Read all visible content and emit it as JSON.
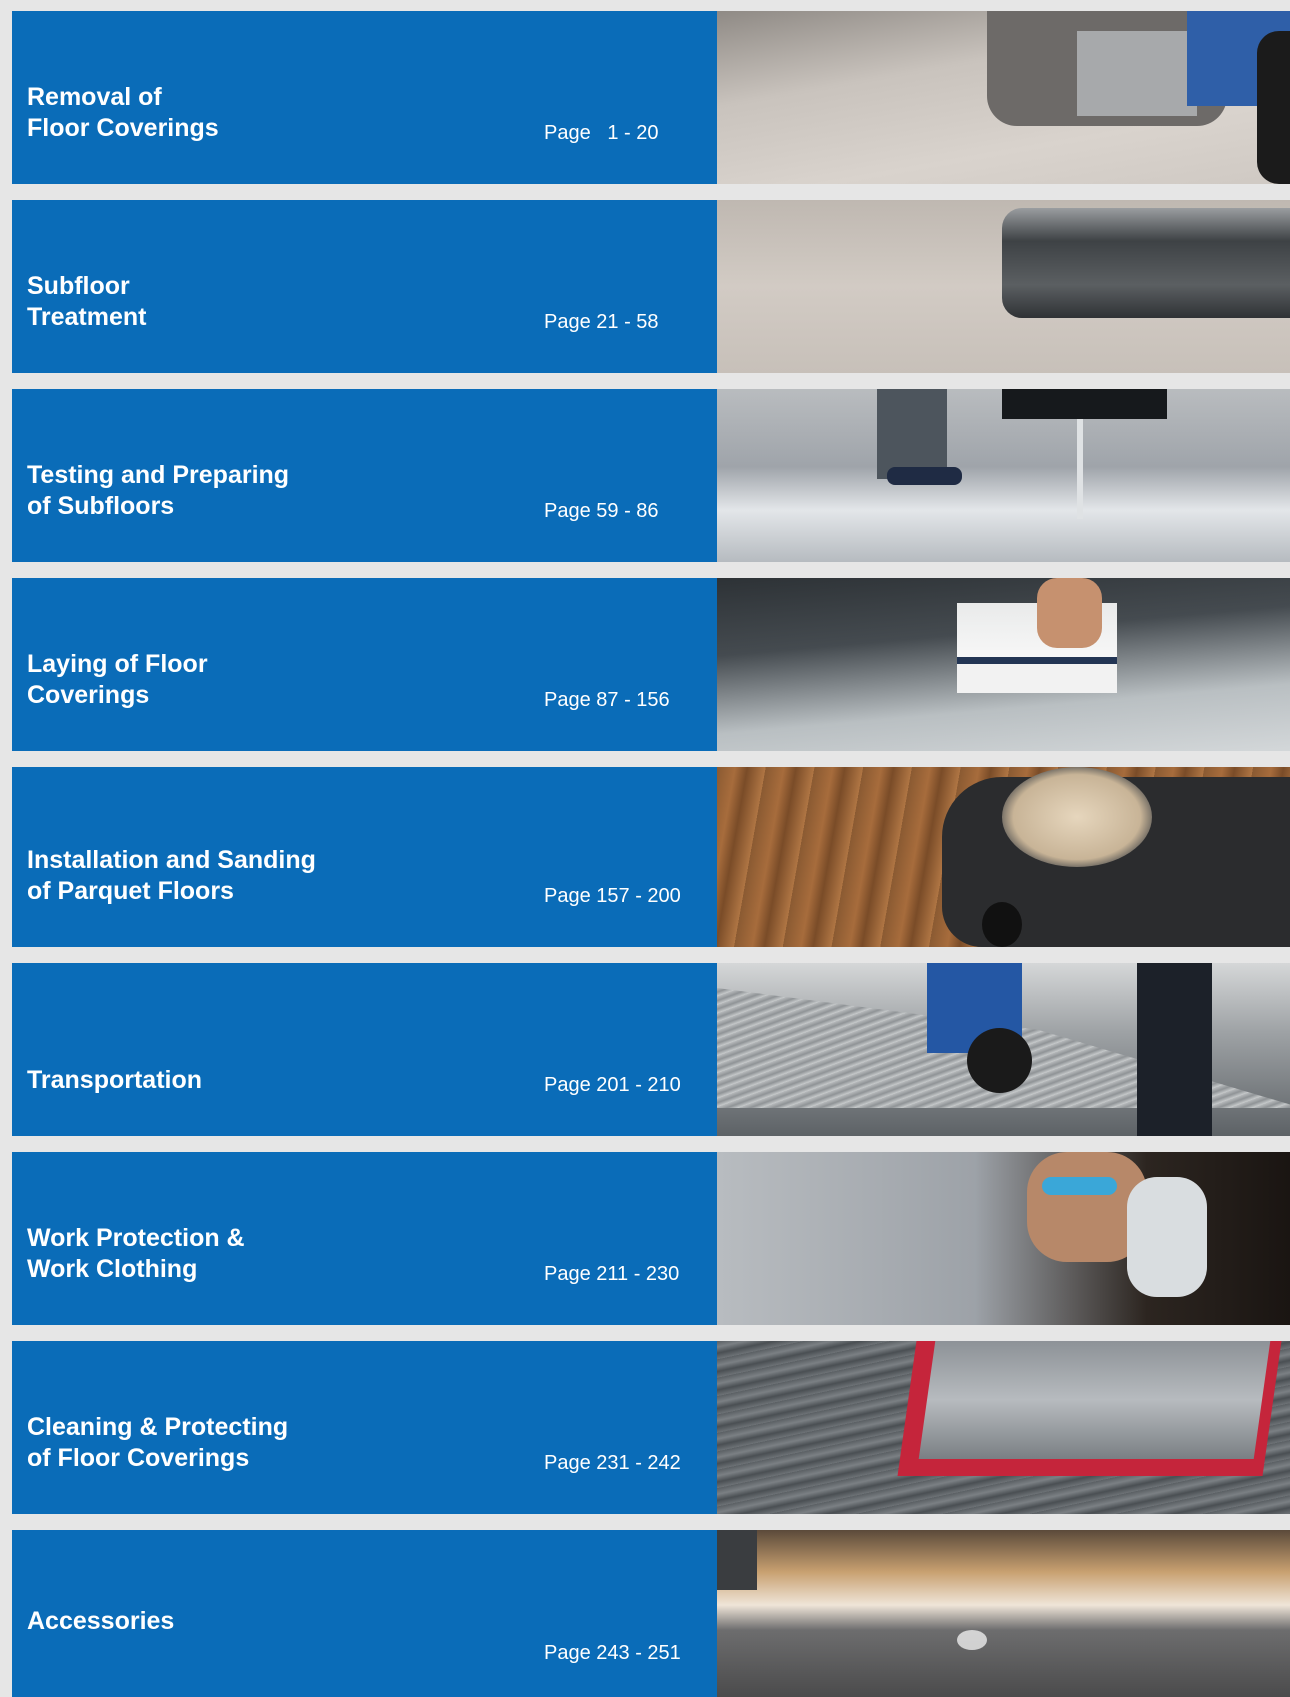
{
  "sections": [
    {
      "title": "Removal of\nFloor Coverings",
      "pages": "Page   1 - 20"
    },
    {
      "title": "Subfloor\nTreatment",
      "pages": "Page 21 - 58"
    },
    {
      "title": "Testing and Preparing\nof Subfloors",
      "pages": "Page 59 - 86"
    },
    {
      "title": "Laying of Floor\nCoverings",
      "pages": "Page 87 - 156"
    },
    {
      "title": "Installation and Sanding\nof Parquet Floors",
      "pages": "Page 157 - 200"
    },
    {
      "title": "Transportation",
      "pages": "Page 201 - 210"
    },
    {
      "title": "Work Protection &\nWork Clothing",
      "pages": "Page 211 - 230"
    },
    {
      "title": "Cleaning & Protecting\nof Floor Coverings",
      "pages": "Page 231 - 242"
    },
    {
      "title": "Accessories",
      "pages": "Page 243 - 251"
    }
  ],
  "colors": {
    "panel": "#0a6cb8",
    "background": "#e6e6e6",
    "text": "#ffffff"
  }
}
